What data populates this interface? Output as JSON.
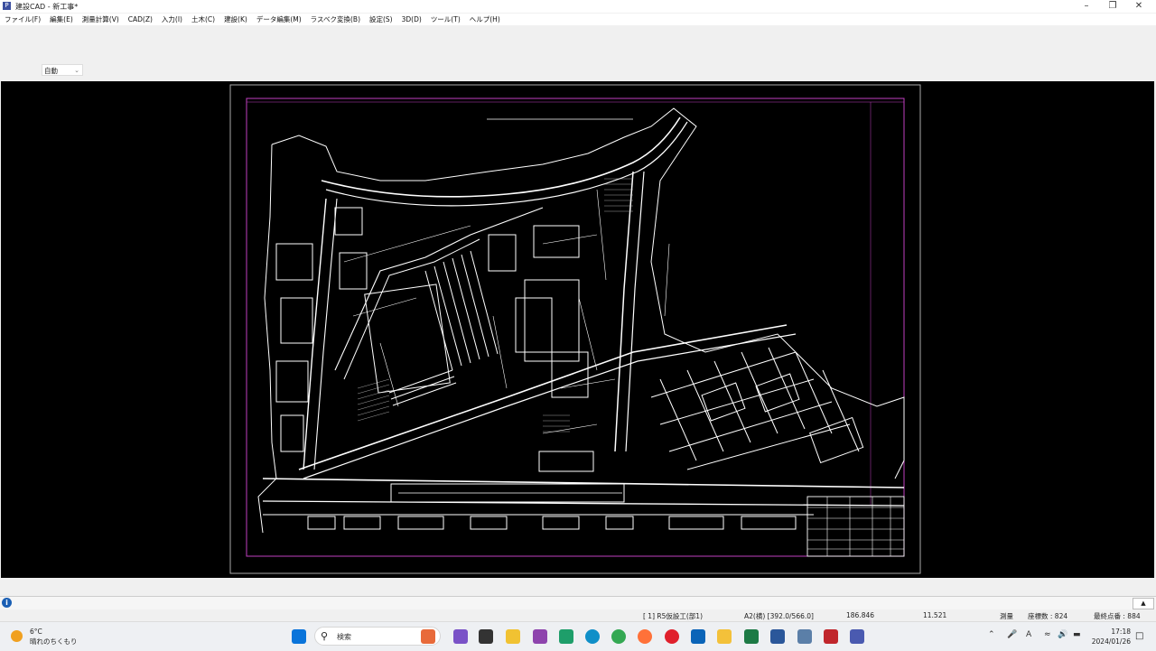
{
  "window": {
    "title": "建設CAD - 新工事*",
    "app_icon": "cad-app-icon"
  },
  "menu": [
    "ファイル(F)",
    "編集(E)",
    "測量計算(V)",
    "CAD(Z)",
    "入力(I)",
    "土木(C)",
    "建設(K)",
    "データ編集(M)",
    "ラスベク変換(B)",
    "設定(S)",
    "3D(D)",
    "ツール(T)",
    "ヘルプ(H)"
  ],
  "toolbar": {
    "mode_value": "自動"
  },
  "status": {
    "layer": "[ 1] R5仮設工(部1)",
    "paper": "A2(横) [392.0/566.0]",
    "x": "186.846",
    "y": "11.521",
    "mode": "測量",
    "coord_count": "座標数 : 824",
    "last_point": "最終点番 : 884"
  },
  "taskbar": {
    "weather_temp": "6°C",
    "weather_desc": "晴れのちくもり",
    "search_placeholder": "検索",
    "time": "17:18",
    "date": "2024/01/26"
  },
  "colors": {
    "canvas_bg": "#000000",
    "drawing_line": "#ffffff",
    "frame_magenta": "#c040c0"
  }
}
